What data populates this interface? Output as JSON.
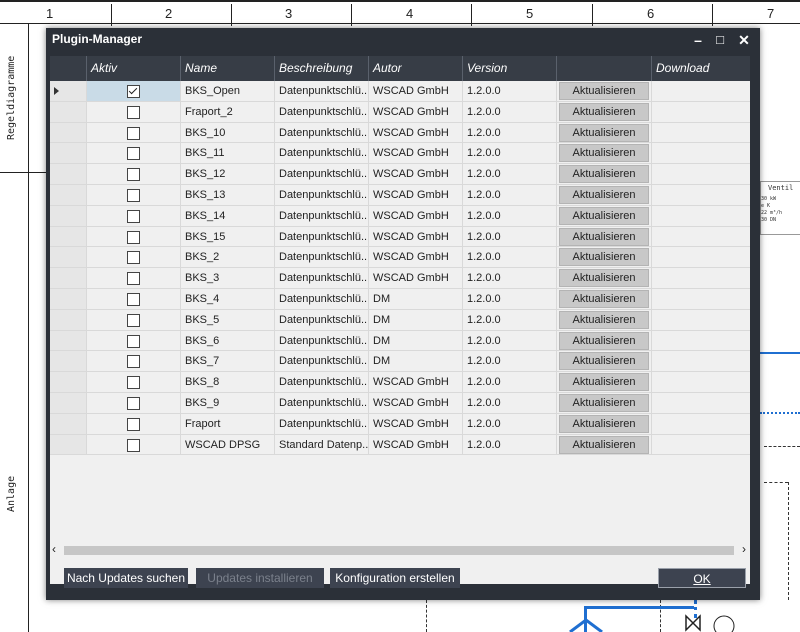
{
  "sheet": {
    "columns": [
      "1",
      "2",
      "3",
      "4",
      "5",
      "6",
      "7"
    ],
    "side_labels": {
      "top": "Regeldiagramme",
      "bottom": "Anlage"
    },
    "ventil": {
      "title": "Ventil",
      "lines": [
        "30 kW",
        "e K",
        "22 m³/h",
        "30 DN"
      ]
    }
  },
  "dialog": {
    "title": "Plugin-Manager",
    "controls": {
      "minimize": "–",
      "maximize": "□",
      "close": "✕"
    },
    "columns": [
      "Aktiv",
      "Name",
      "Beschreibung",
      "Autor",
      "Version",
      "",
      "Download"
    ],
    "update_button_label": "Aktualisieren",
    "rows": [
      {
        "active": true,
        "name": "BKS_Open",
        "description": "Datenpunktschlü...",
        "author": "WSCAD GmbH",
        "version": "1.2.0.0"
      },
      {
        "active": false,
        "name": "Fraport_2",
        "description": "Datenpunktschlü...",
        "author": "WSCAD GmbH",
        "version": "1.2.0.0"
      },
      {
        "active": false,
        "name": "BKS_10",
        "description": "Datenpunktschlü...",
        "author": "WSCAD GmbH",
        "version": "1.2.0.0"
      },
      {
        "active": false,
        "name": "BKS_11",
        "description": "Datenpunktschlü...",
        "author": "WSCAD GmbH",
        "version": "1.2.0.0"
      },
      {
        "active": false,
        "name": "BKS_12",
        "description": "Datenpunktschlü...",
        "author": "WSCAD GmbH",
        "version": "1.2.0.0"
      },
      {
        "active": false,
        "name": "BKS_13",
        "description": "Datenpunktschlü...",
        "author": "WSCAD GmbH",
        "version": "1.2.0.0"
      },
      {
        "active": false,
        "name": "BKS_14",
        "description": "Datenpunktschlü...",
        "author": "WSCAD GmbH",
        "version": "1.2.0.0"
      },
      {
        "active": false,
        "name": "BKS_15",
        "description": "Datenpunktschlü...",
        "author": "WSCAD GmbH",
        "version": "1.2.0.0"
      },
      {
        "active": false,
        "name": "BKS_2",
        "description": "Datenpunktschlü...",
        "author": "WSCAD GmbH",
        "version": "1.2.0.0"
      },
      {
        "active": false,
        "name": "BKS_3",
        "description": "Datenpunktschlü...",
        "author": "WSCAD GmbH",
        "version": "1.2.0.0"
      },
      {
        "active": false,
        "name": "BKS_4",
        "description": "Datenpunktschlü...",
        "author": "DM",
        "version": "1.2.0.0"
      },
      {
        "active": false,
        "name": "BKS_5",
        "description": "Datenpunktschlü...",
        "author": "DM",
        "version": "1.2.0.0"
      },
      {
        "active": false,
        "name": "BKS_6",
        "description": "Datenpunktschlü...",
        "author": "DM",
        "version": "1.2.0.0"
      },
      {
        "active": false,
        "name": "BKS_7",
        "description": "Datenpunktschlü...",
        "author": "DM",
        "version": "1.2.0.0"
      },
      {
        "active": false,
        "name": "BKS_8",
        "description": "Datenpunktschlü...",
        "author": "WSCAD GmbH",
        "version": "1.2.0.0"
      },
      {
        "active": false,
        "name": "BKS_9",
        "description": "Datenpunktschlü...",
        "author": "WSCAD GmbH",
        "version": "1.2.0.0"
      },
      {
        "active": false,
        "name": "Fraport",
        "description": "Datenpunktschlü...",
        "author": "WSCAD GmbH",
        "version": "1.2.0.0"
      },
      {
        "active": false,
        "name": "WSCAD DPSG",
        "description": "Standard Datenp...",
        "author": "WSCAD GmbH",
        "version": "1.2.0.0"
      }
    ],
    "footer": {
      "check_updates": "Nach Updates suchen",
      "install_updates": "Updates installieren",
      "create_config": "Konfiguration erstellen",
      "ok": "OK"
    },
    "colors": {
      "frame": "#2b3038",
      "header": "#373d46",
      "selected_row": "#c9dbe7",
      "accent_line": "#1f6fd1"
    }
  }
}
